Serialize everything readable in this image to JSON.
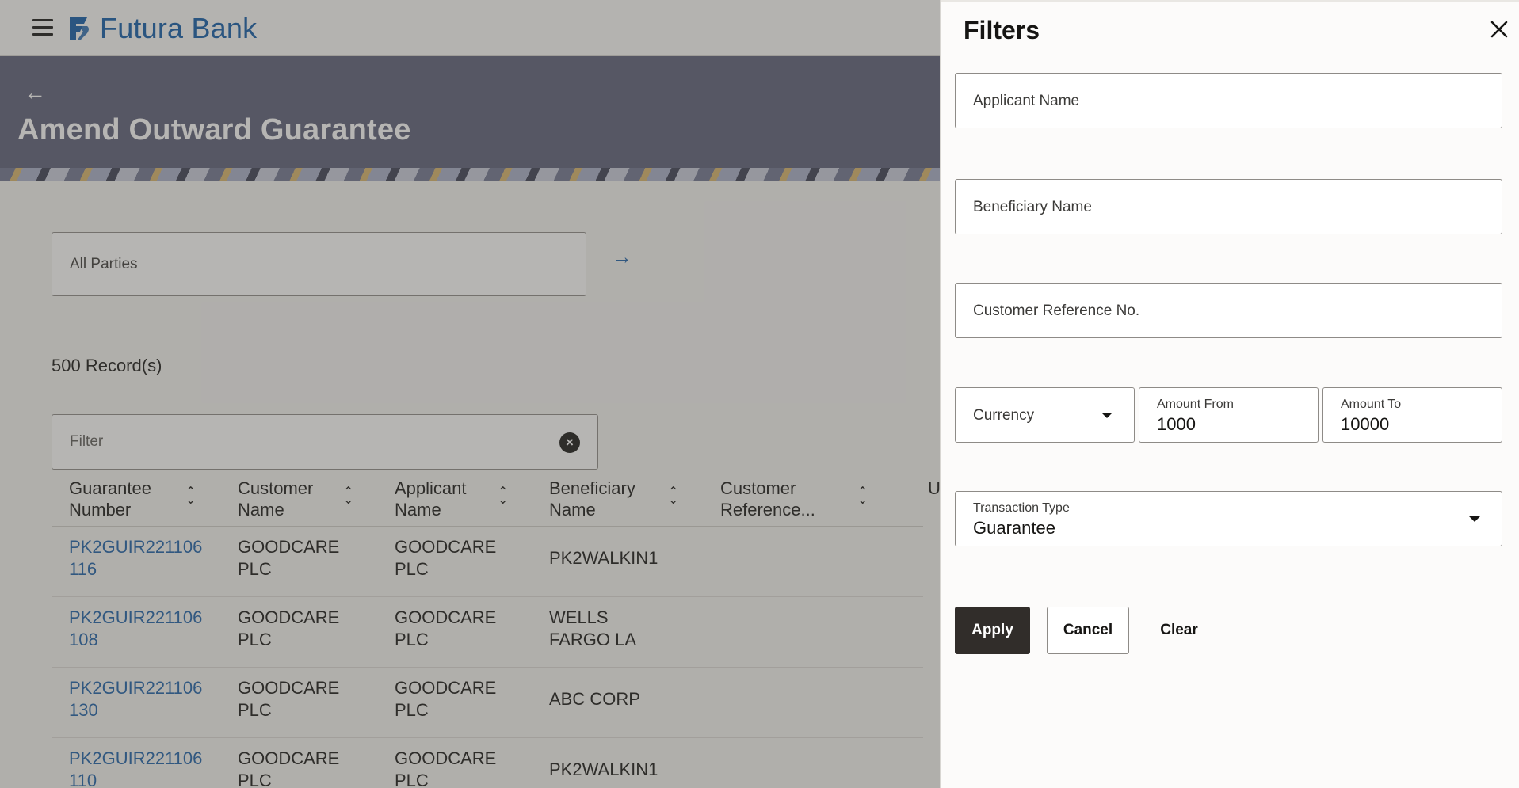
{
  "brand": {
    "name": "Futura Bank",
    "color": "#0e5aa7"
  },
  "page": {
    "title": "Amend Outward Guarantee"
  },
  "party_select": {
    "value": "All Parties"
  },
  "records": {
    "count_label": "500 Record(s)"
  },
  "table_filter": {
    "placeholder": "Filter"
  },
  "table": {
    "headers": {
      "guarantee_number": "Guarantee Number",
      "customer_name": "Customer Name",
      "applicant_name": "Applicant Name",
      "beneficiary_name": "Beneficiary Name",
      "customer_reference": "Customer Reference...",
      "truncated_next": "U"
    },
    "rows": [
      {
        "guarantee_number": "PK2GUIR221106116",
        "customer_name": "GOODCARE PLC",
        "applicant_name": "GOODCARE PLC",
        "beneficiary_name": "PK2WALKIN1"
      },
      {
        "guarantee_number": "PK2GUIR221106108",
        "customer_name": "GOODCARE PLC",
        "applicant_name": "GOODCARE PLC",
        "beneficiary_name": "WELLS FARGO LA"
      },
      {
        "guarantee_number": "PK2GUIR221106130",
        "customer_name": "GOODCARE PLC",
        "applicant_name": "GOODCARE PLC",
        "beneficiary_name": "ABC CORP"
      },
      {
        "guarantee_number": "PK2GUIR221106110",
        "customer_name": "GOODCARE PLC",
        "applicant_name": "GOODCARE PLC",
        "beneficiary_name": "PK2WALKIN1"
      }
    ]
  },
  "filters_panel": {
    "title": "Filters",
    "applicant_name": {
      "placeholder": "Applicant Name"
    },
    "beneficiary_name": {
      "placeholder": "Beneficiary Name"
    },
    "customer_reference": {
      "placeholder": "Customer Reference No."
    },
    "currency": {
      "placeholder": "Currency"
    },
    "amount_from": {
      "label": "Amount From",
      "value": "1000"
    },
    "amount_to": {
      "label": "Amount To",
      "value": "10000"
    },
    "transaction_type": {
      "label": "Transaction Type",
      "value": "Guarantee"
    },
    "buttons": {
      "apply": "Apply",
      "cancel": "Cancel",
      "clear": "Clear"
    }
  },
  "icons": {
    "menu": "hamburger-icon",
    "back": "arrow-left-icon",
    "go": "arrow-right-icon",
    "clear_filter": "close-circle-icon",
    "sort": "sort-icon",
    "close_panel": "close-icon",
    "dropdown": "caret-down-icon"
  },
  "colors": {
    "hero_background": "#5b5e77",
    "link": "#1b5fa8",
    "primary_button": "#312d2a"
  }
}
